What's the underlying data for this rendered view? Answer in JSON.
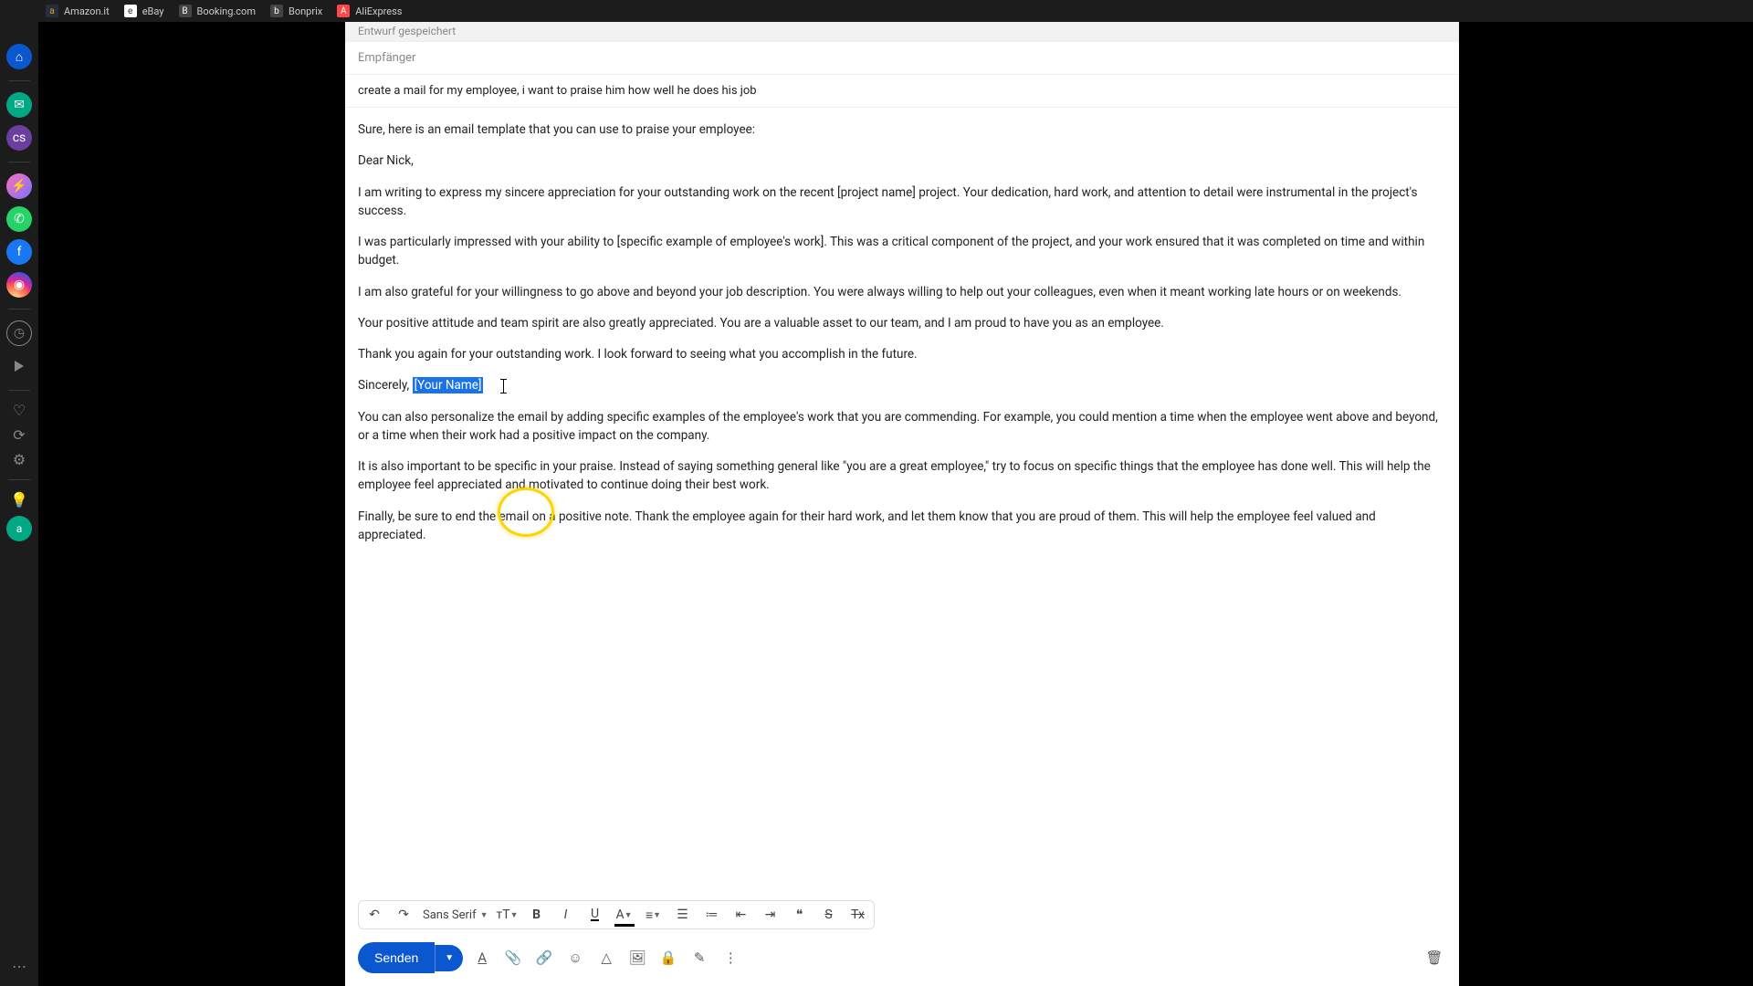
{
  "bookmarks": [
    {
      "label": "Amazon.it",
      "icon": "a"
    },
    {
      "label": "eBay",
      "icon": "e"
    },
    {
      "label": "Booking.com",
      "icon": "B"
    },
    {
      "label": "Bonprix",
      "icon": "b"
    },
    {
      "label": "AliExpress",
      "icon": "A"
    }
  ],
  "compose": {
    "draft_status": "Entwurf gespeichert",
    "recipient_placeholder": "Empfänger",
    "subject": "create a mail for my employee, i want to praise him how well he does his job",
    "intro": "Sure, here is an email template that you can use to praise your employee:",
    "greeting": "Dear Nick,",
    "p1": "I am writing to express my sincere appreciation for your outstanding work on the recent [project name] project. Your dedication, hard work, and attention to detail were instrumental in the project's success.",
    "p2": "I was particularly impressed with your ability to [specific example of employee's work]. This was a critical component of the project, and your work ensured that it was completed on time and within budget.",
    "p3": "I am also grateful for your willingness to go above and beyond your job description. You were always willing to help out your colleagues, even when it meant working late hours or on weekends.",
    "p4": "Your positive attitude and team spirit are also greatly appreciated. You are a valuable asset to our team, and I am proud to have you as an employee.",
    "p5": "Thank you again for your outstanding work. I look forward to seeing what you accomplish in the future.",
    "closing_pre": "Sincerely, ",
    "closing_selected": "[Your Name]",
    "tip1": "You can also personalize the email by adding specific examples of the employee's work that you are commending. For example, you could mention a time when the employee went above and beyond, or a time when their work had a positive impact on the company.",
    "tip2": "It is also important to be specific in your praise. Instead of saying something general like \"you are a great employee,\" try to focus on specific things that the employee has done well. This will help the employee feel appreciated and motivated to continue doing their best work.",
    "tip3": "Finally, be sure to end the email on a positive note. Thank the employee again for their hard work, and let them know that you are proud of them. This will help the employee feel valued and appreciated."
  },
  "toolbar": {
    "font": "Sans Serif",
    "send_label": "Senden"
  }
}
